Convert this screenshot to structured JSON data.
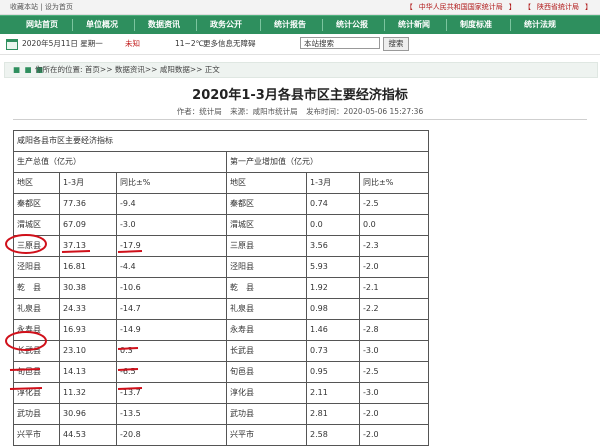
{
  "topbar": {
    "links": [
      "收藏本站",
      "设为首页"
    ],
    "separator": "|",
    "right_links": [
      "【",
      "中华人民共和国国家统计局",
      "】",
      "【",
      "陕西省统计局",
      "】"
    ]
  },
  "nav": {
    "items": [
      "网站首页",
      "单位概况",
      "数据资讯",
      "政务公开",
      "统计报告",
      "统计公报",
      "统计新闻",
      "制度标准",
      "统计法规"
    ]
  },
  "infobar": {
    "date": "2020年5月11日 星期一",
    "weather_unknown": "未知",
    "temperature": "11~2℃",
    "more": "更多信息无障碍",
    "search_value": "本站搜索",
    "search_button": "搜索"
  },
  "breadcrumb": {
    "dots": "■ ■ ■",
    "label": "你所在的位置:",
    "path": "首页>> 数据资讯>> 咸阳数据>> 正文"
  },
  "article": {
    "title": "2020年1-3月各县市区主要经济指标",
    "author": "作者：统计局",
    "source": "来源：咸阳市统计局",
    "published": "发布时间：2020-05-06 15:27:36"
  },
  "table": {
    "caption": "咸阳各县市区主要经济指标",
    "group_left": "生产总值（亿元）",
    "group_right": "第一产业增加值（亿元）",
    "headers": [
      "地区",
      "1-3月",
      "同比±%",
      "地区",
      "1-3月",
      "同比±%"
    ],
    "rows": [
      [
        "秦都区",
        "77.36",
        "-9.4",
        "秦都区",
        "0.74",
        "-2.5"
      ],
      [
        "渭城区",
        "67.09",
        "-3.0",
        "渭城区",
        "0.0",
        "0.0"
      ],
      [
        "三原县",
        "37.13",
        "-17.9",
        "三原县",
        "3.56",
        "-2.3"
      ],
      [
        "泾阳县",
        "16.81",
        "-4.4",
        "泾阳县",
        "5.93",
        "-2.0"
      ],
      [
        "乾　县",
        "30.38",
        "-10.6",
        "乾　县",
        "1.92",
        "-2.1"
      ],
      [
        "礼泉县",
        "24.33",
        "-14.7",
        "礼泉县",
        "0.98",
        "-2.2"
      ],
      [
        "永寿县",
        "16.93",
        "-14.9",
        "永寿县",
        "1.46",
        "-2.8"
      ],
      [
        "长武县",
        "23.10",
        "0.3",
        "长武县",
        "0.73",
        "-3.0"
      ],
      [
        "旬邑县",
        "14.13",
        "-6.5",
        "旬邑县",
        "0.95",
        "-2.5"
      ],
      [
        "淳化县",
        "11.32",
        "-13.7",
        "淳化县",
        "2.11",
        "-3.0"
      ],
      [
        "武功县",
        "30.96",
        "-13.5",
        "武功县",
        "2.81",
        "-2.0"
      ],
      [
        "兴平市",
        "44.53",
        "-20.8",
        "兴平市",
        "2.58",
        "-2.0"
      ]
    ]
  },
  "annotations": {
    "color": "#d0101a"
  }
}
